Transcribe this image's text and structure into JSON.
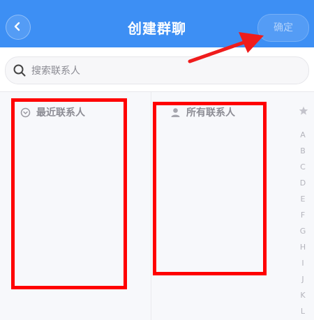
{
  "header": {
    "title": "创建群聊",
    "confirm_label": "确定",
    "accent": "#3d8ff4"
  },
  "search": {
    "placeholder": "搜索联系人"
  },
  "sections": {
    "recent_label": "最近联系人",
    "all_label": "所有联系人"
  },
  "index_letters": [
    "A",
    "B",
    "C",
    "D",
    "E",
    "F",
    "G",
    "H",
    "I",
    "J",
    "K",
    "L"
  ],
  "annotation_color": "#ff0000"
}
